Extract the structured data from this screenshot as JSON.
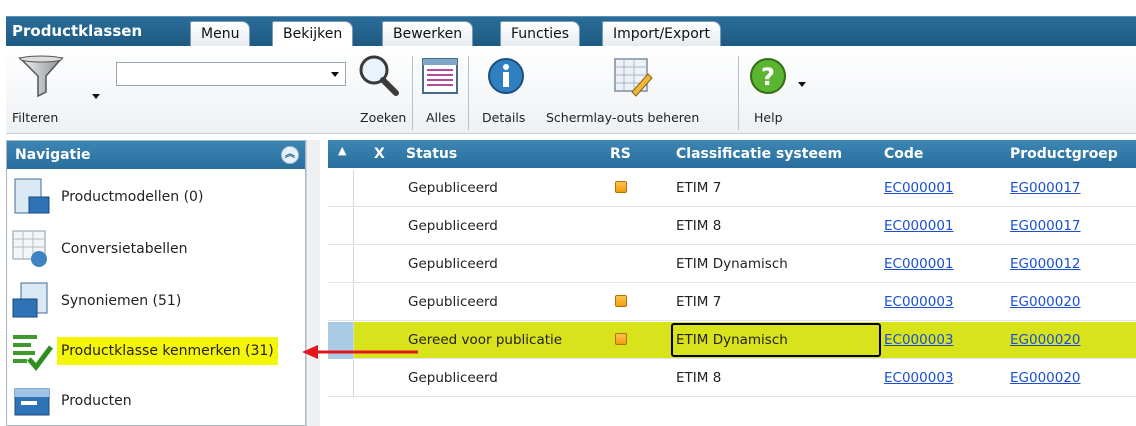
{
  "app": {
    "title": "Productklassen"
  },
  "tabs": [
    {
      "label": "Menu"
    },
    {
      "label": "Bekijken"
    },
    {
      "label": "Bewerken"
    },
    {
      "label": "Functies"
    },
    {
      "label": "Import/Export"
    }
  ],
  "ribbon": {
    "filter_label": "Filteren",
    "search_value": "",
    "search_label": "Zoeken",
    "all_label": "Alles",
    "details_label": "Details",
    "layouts_label": "Schermlay-outs beheren",
    "help_label": "Help"
  },
  "navigation": {
    "title": "Navigatie",
    "items": [
      {
        "label": "Productmodellen (0)",
        "icon": "product-model-icon"
      },
      {
        "label": "Conversietabellen",
        "icon": "conversion-table-icon"
      },
      {
        "label": "Synoniemen (51)",
        "icon": "synonyms-icon"
      },
      {
        "label": "Productklasse kenmerken (31)",
        "icon": "class-features-icon",
        "highlighted": true
      },
      {
        "label": "Producten",
        "icon": "products-icon"
      }
    ]
  },
  "grid": {
    "columns": {
      "x": "X",
      "status": "Status",
      "rs": "RS",
      "classification": "Classificatie systeem",
      "code": "Code",
      "group": "Productgroep"
    },
    "rows": [
      {
        "status": "Gepubliceerd",
        "rs": true,
        "classification": "ETIM 7",
        "code": "EC000001",
        "group": "EG000017"
      },
      {
        "status": "Gepubliceerd",
        "rs": false,
        "classification": "ETIM 8",
        "code": "EC000001",
        "group": "EG000017"
      },
      {
        "status": "Gepubliceerd",
        "rs": false,
        "classification": "ETIM Dynamisch",
        "code": "EC000001",
        "group": "EG000012"
      },
      {
        "status": "Gepubliceerd",
        "rs": true,
        "classification": "ETIM 7",
        "code": "EC000003",
        "group": "EG000020"
      },
      {
        "status": "Gereed voor publicatie",
        "rs": true,
        "classification": "ETIM Dynamisch",
        "code": "EC000003",
        "group": "EG000020",
        "selected": true
      },
      {
        "status": "Gepubliceerd",
        "rs": false,
        "classification": "ETIM 8",
        "code": "EC000003",
        "group": "EG000020"
      }
    ]
  },
  "colors": {
    "header_blue": "#286f9e",
    "highlight_yellow": "#f5f508",
    "selected_row": "#d9e31b",
    "arrow_red": "#e3161d",
    "link": "#1a4fd1"
  }
}
